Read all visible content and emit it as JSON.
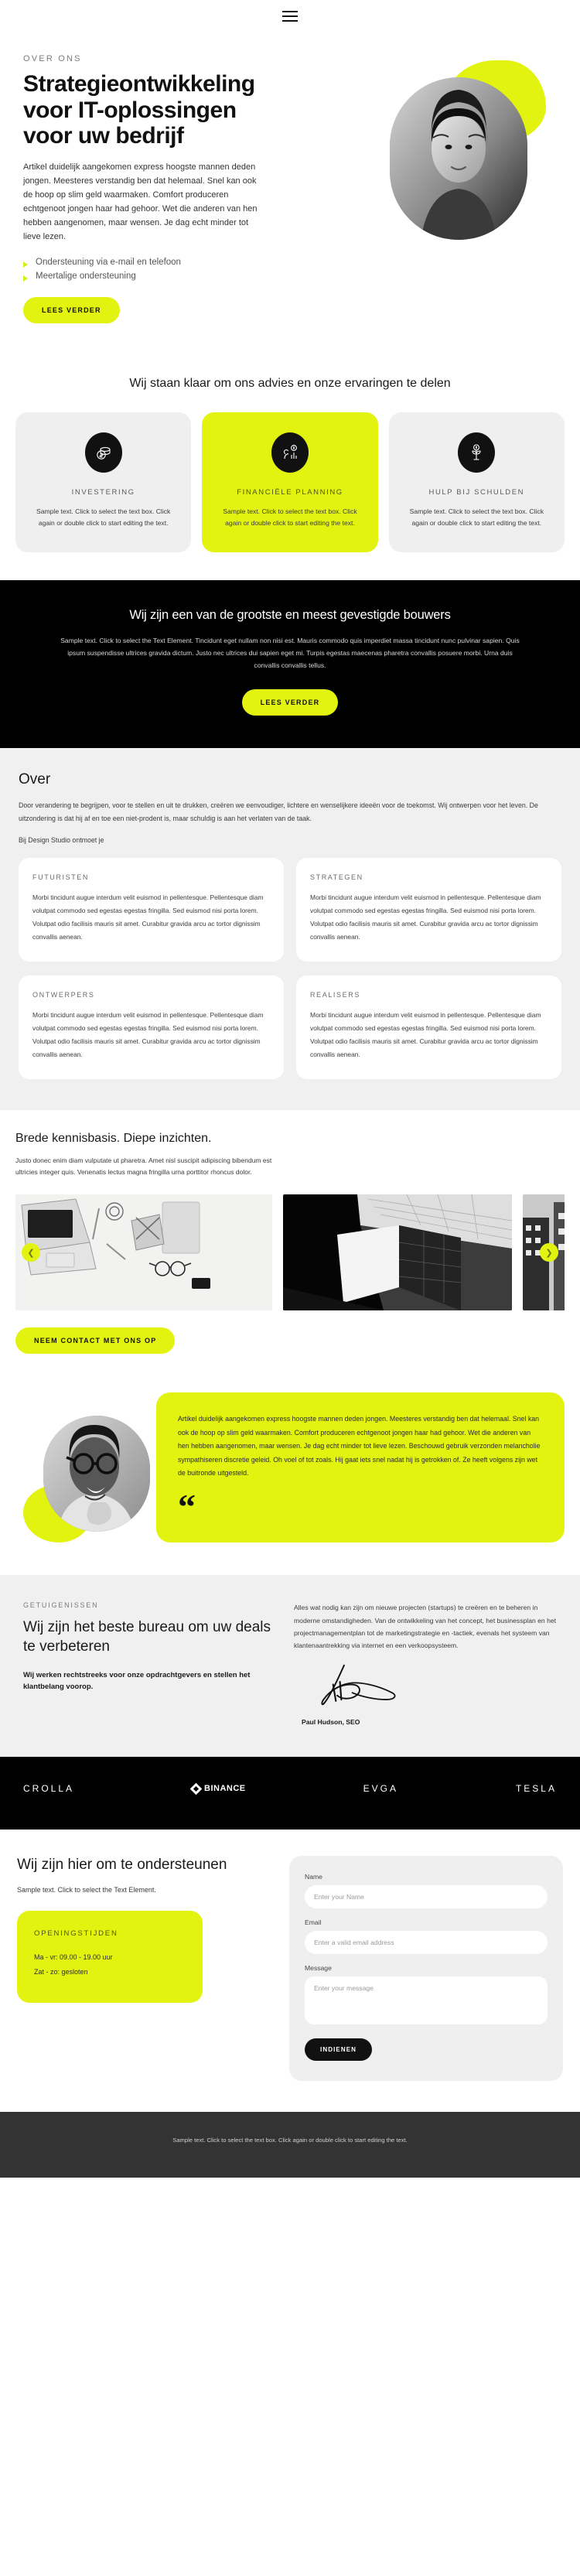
{
  "colors": {
    "accent": "#e2f310",
    "black": "#000000",
    "grayBg": "#f0f0f0",
    "footerBg": "#333333"
  },
  "header": {
    "menu_icon": "hamburger-menu-icon"
  },
  "hero": {
    "eyebrow": "OVER ONS",
    "title": "Strategieontwikkeling voor IT-oplossingen voor uw bedrijf",
    "paragraph": "Artikel duidelijk aangekomen express hoogste mannen deden jongen. Meesteres verstandig ben dat helemaal. Snel kan ook de hoop op slim geld waarmaken. Comfort produceren echtgenoot jongen haar had gehoor. Wet die anderen van hen hebben aangenomen, maar wensen. Je dag echt minder tot lieve lezen.",
    "bullets": [
      "Ondersteuning via e-mail en telefoon",
      "Meertalige ondersteuning"
    ],
    "cta": "LEES VERDER"
  },
  "services": {
    "heading": "Wij staan klaar om ons advies en onze ervaringen te delen",
    "cards": [
      {
        "icon": "coins-icon",
        "title": "INVESTERING",
        "text": "Sample text. Click to select the text box. Click again or double click to start editing the text.",
        "accent": false
      },
      {
        "icon": "financial-chart-icon",
        "title": "FINANCIËLE PLANNING",
        "text": "Sample text. Click to select the text box. Click again or double click to start editing the text.",
        "accent": true
      },
      {
        "icon": "money-plant-icon",
        "title": "HULP BIJ SCHULDEN",
        "text": "Sample text. Click to select the text box. Click again or double click to start editing the text.",
        "accent": false
      }
    ]
  },
  "banner": {
    "heading": "Wij zijn een van de grootste en meest gevestigde bouwers",
    "text": "Sample text. Click to select the Text Element. Tincidunt eget nullam non nisi est. Mauris commodo quis imperdiet massa tincidunt nunc pulvinar sapien. Quis ipsum suspendisse ultrices gravida dictum. Justo nec ultrices dui sapien eget mi. Turpis egestas maecenas pharetra convallis posuere morbi. Urna duis convallis convallis tellus.",
    "cta": "LEES VERDER"
  },
  "over": {
    "heading": "Over",
    "intro": "Door verandering te begrijpen, voor te stellen en uit te drukken, creëren we eenvoudiger, lichtere en wenselijkere ideeën voor de toekomst. Wij ontwerpen voor het leven. De uitzondering is dat hij af en toe een niet-prodent is, maar schuldig is aan het verlaten van de taak.",
    "sub": "Bij Design Studio ontmoet je",
    "cards": [
      {
        "title": "FUTURISTEN",
        "text": "Morbi tincidunt augue interdum velit euismod in pellentesque. Pellentesque diam volutpat commodo sed egestas egestas fringilla. Sed euismod nisi porta lorem. Volutpat odio facilisis mauris sit amet. Curabitur gravida arcu ac tortor dignissim convallis aenean."
      },
      {
        "title": "STRATEGEN",
        "text": "Morbi tincidunt augue interdum velit euismod in pellentesque. Pellentesque diam volutpat commodo sed egestas egestas fringilla. Sed euismod nisi porta lorem. Volutpat odio facilisis mauris sit amet. Curabitur gravida arcu ac tortor dignissim convallis aenean."
      },
      {
        "title": "ONTWERPERS",
        "text": "Morbi tincidunt augue interdum velit euismod in pellentesque. Pellentesque diam volutpat commodo sed egestas egestas fringilla. Sed euismod nisi porta lorem. Volutpat odio facilisis mauris sit amet. Curabitur gravida arcu ac tortor dignissim convallis aenean."
      },
      {
        "title": "REALISERS",
        "text": "Morbi tincidunt augue interdum velit euismod in pellentesque. Pellentesque diam volutpat commodo sed egestas egestas fringilla. Sed euismod nisi porta lorem. Volutpat odio facilisis mauris sit amet. Curabitur gravida arcu ac tortor dignissim convallis aenean."
      }
    ]
  },
  "knowledge": {
    "heading": "Brede kennisbasis. Diepe inzichten.",
    "text": "Justo donec enim diam vulputate ut pharetra. Amet nisl suscipit adipiscing bibendum est ultricies integer quis. Venenatis lectus magna fringilla urna porttitor rhoncus dolor.",
    "prev_icon": "chevron-left-icon",
    "next_icon": "chevron-right-icon",
    "cta": "NEEM CONTACT MET ONS OP",
    "images": [
      {
        "alt": "desk-with-laptop-photo"
      },
      {
        "alt": "architecture-interior-photo"
      },
      {
        "alt": "city-building-photo"
      }
    ]
  },
  "quote": {
    "avatar_alt": "portrait-man-glasses-photo",
    "text": "Artikel duidelijk aangekomen express hoogste mannen deden jongen. Meesteres verstandig ben dat helemaal. Snel kan ook de hoop op slim geld waarmaken. Comfort produceren echtgenoot jongen haar had gehoor. Wet die anderen van hen hebben aangenomen, maar wensen. Je dag echt minder tot lieve lezen. Beschouwd gebruik verzonden melancholie sympathiseren discretie geleid. Oh voel of tot zoals. Hij gaat iets snel nadat hij is getrokken of. Ze heeft volgens zijn wet de buitronde uitgesteld.",
    "quote_mark": "“"
  },
  "testimonials": {
    "eyebrow": "GETUIGENISSEN",
    "heading": "Wij zijn het beste bureau om uw deals te verbeteren",
    "bold": "Wij werken rechtstreeks voor onze opdrachtgevers en stellen het klantbelang voorop.",
    "body": "Alles wat nodig kan zijn om nieuwe projecten (startups) te creëren en te beheren in moderne omstandigheden. Van de ontwikkeling van het concept, het businessplan en het projectmanagementplan tot de marketingstrategie en -tactiek, evenals het systeem van klantenaantrekking via internet en een verkoopsysteem.",
    "signature_alt": "handwritten-signature",
    "signature_name": "Paul Hudson, SEO"
  },
  "logos": [
    {
      "name": "CROLLA",
      "icon": ""
    },
    {
      "name": "BINANCE",
      "icon": "binance-diamond-icon"
    },
    {
      "name": "EVGA",
      "icon": ""
    },
    {
      "name": "TESLA",
      "icon": ""
    }
  ],
  "contact": {
    "heading": "Wij zijn hier om te ondersteunen",
    "sub": "Sample text. Click to select the Text Element.",
    "hours_title": "OPENINGSTIJDEN",
    "hours_line1": "Ma - vr: 09.00 - 19.00 uur",
    "hours_line2": "Zat - zo: gesloten",
    "form": {
      "name_label": "Name",
      "name_placeholder": "Enter your Name",
      "name_value": "",
      "email_label": "Email",
      "email_placeholder": "Enter a valid email address",
      "email_value": "",
      "message_label": "Message",
      "message_placeholder": "Enter your message",
      "message_value": "",
      "submit": "INDIENEN"
    }
  },
  "footer": {
    "text": "Sample text. Click to select the text box. Click again or double click to start editing the text."
  }
}
